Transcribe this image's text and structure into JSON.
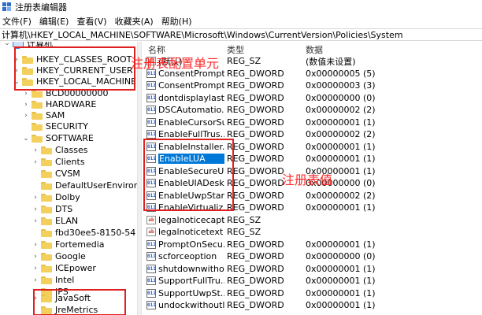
{
  "window": {
    "title": "注册表编辑器"
  },
  "menu": [
    "文件(F)",
    "编辑(E)",
    "查看(V)",
    "收藏夹(A)",
    "帮助(H)"
  ],
  "address": "计算机\\HKEY_LOCAL_MACHINE\\SOFTWARE\\Microsoft\\Windows\\CurrentVersion\\Policies\\System",
  "tree": {
    "root": "计算机",
    "items": [
      {
        "label": "HKEY_CLASSES_ROOT",
        "arrow": "›"
      },
      {
        "label": "HKEY_CURRENT_USER",
        "arrow": "›"
      },
      {
        "label": "HKEY_LOCAL_MACHINE",
        "arrow": "⌄"
      },
      {
        "label": "BCD00000000",
        "arrow": "›"
      },
      {
        "label": "HARDWARE",
        "arrow": "›"
      },
      {
        "label": "SAM",
        "arrow": "›"
      },
      {
        "label": "SECURITY",
        "arrow": ""
      },
      {
        "label": "SOFTWARE",
        "arrow": "⌄"
      },
      {
        "label": "Classes",
        "arrow": "›"
      },
      {
        "label": "Clients",
        "arrow": "›"
      },
      {
        "label": "CVSM",
        "arrow": ""
      },
      {
        "label": "DefaultUserEnviron",
        "arrow": ""
      },
      {
        "label": "Dolby",
        "arrow": "›"
      },
      {
        "label": "DTS",
        "arrow": "›"
      },
      {
        "label": "ELAN",
        "arrow": "›"
      },
      {
        "label": "fbd30ee5-8150-54",
        "arrow": ""
      },
      {
        "label": "Fortemedia",
        "arrow": "›"
      },
      {
        "label": "Google",
        "arrow": "›"
      },
      {
        "label": "ICEpower",
        "arrow": "›"
      },
      {
        "label": "Intel",
        "arrow": "›"
      },
      {
        "label": "IPS",
        "arrow": ""
      },
      {
        "label": "JavaSoft",
        "arrow": "›"
      },
      {
        "label": "JreMetrics",
        "arrow": ""
      }
    ]
  },
  "columns": {
    "name": "名称",
    "type": "类型",
    "data": "数据"
  },
  "values": [
    {
      "icon": "ab",
      "name": "(默认)",
      "type": "REG_SZ",
      "data": "(数值未设置)"
    },
    {
      "icon": "bin",
      "name": "ConsentPrompt...",
      "type": "REG_DWORD",
      "data": "0x00000005 (5)"
    },
    {
      "icon": "bin",
      "name": "ConsentPrompt...",
      "type": "REG_DWORD",
      "data": "0x00000003 (3)"
    },
    {
      "icon": "bin",
      "name": "dontdisplaylast...",
      "type": "REG_DWORD",
      "data": "0x00000000 (0)"
    },
    {
      "icon": "bin",
      "name": "DSCAutomatio...",
      "type": "REG_DWORD",
      "data": "0x00000002 (2)"
    },
    {
      "icon": "bin",
      "name": "EnableCursorSu...",
      "type": "REG_DWORD",
      "data": "0x00000001 (1)"
    },
    {
      "icon": "bin",
      "name": "EnableFullTrus...",
      "type": "REG_DWORD",
      "data": "0x00000002 (2)"
    },
    {
      "icon": "bin",
      "name": "EnableInstaller...",
      "type": "REG_DWORD",
      "data": "0x00000001 (1)"
    },
    {
      "icon": "bin",
      "name": "EnableLUA",
      "type": "REG_DWORD",
      "data": "0x00000001 (1)",
      "selected": true
    },
    {
      "icon": "bin",
      "name": "EnableSecureUI...",
      "type": "REG_DWORD",
      "data": "0x00000001 (1)"
    },
    {
      "icon": "bin",
      "name": "EnableUIADesk...",
      "type": "REG_DWORD",
      "data": "0x00000000 (0)"
    },
    {
      "icon": "bin",
      "name": "EnableUwpStar...",
      "type": "REG_DWORD",
      "data": "0x00000002 (2)"
    },
    {
      "icon": "bin",
      "name": "EnableVirtualiz...",
      "type": "REG_DWORD",
      "data": "0x00000001 (1)"
    },
    {
      "icon": "ab",
      "name": "legalnoticecapt...",
      "type": "REG_SZ",
      "data": ""
    },
    {
      "icon": "ab",
      "name": "legalnoticetext",
      "type": "REG_SZ",
      "data": ""
    },
    {
      "icon": "bin",
      "name": "PromptOnSecu...",
      "type": "REG_DWORD",
      "data": "0x00000001 (1)"
    },
    {
      "icon": "bin",
      "name": "scforceoption",
      "type": "REG_DWORD",
      "data": "0x00000000 (0)"
    },
    {
      "icon": "bin",
      "name": "shutdownwitho...",
      "type": "REG_DWORD",
      "data": "0x00000001 (1)"
    },
    {
      "icon": "bin",
      "name": "SupportFullTru...",
      "type": "REG_DWORD",
      "data": "0x00000001 (1)"
    },
    {
      "icon": "bin",
      "name": "SupportUwpSt...",
      "type": "REG_DWORD",
      "data": "0x00000001 (1)"
    },
    {
      "icon": "bin",
      "name": "undockwithoutl...",
      "type": "REG_DWORD",
      "data": "0x00000001 (1)"
    }
  ],
  "annotations": {
    "hives": "注册表配置单元",
    "values": "注册表值"
  },
  "colors": {
    "annotation_red": "#e02020",
    "selection_blue": "#0078d7",
    "folder_yellow": "#f3cf5c"
  }
}
